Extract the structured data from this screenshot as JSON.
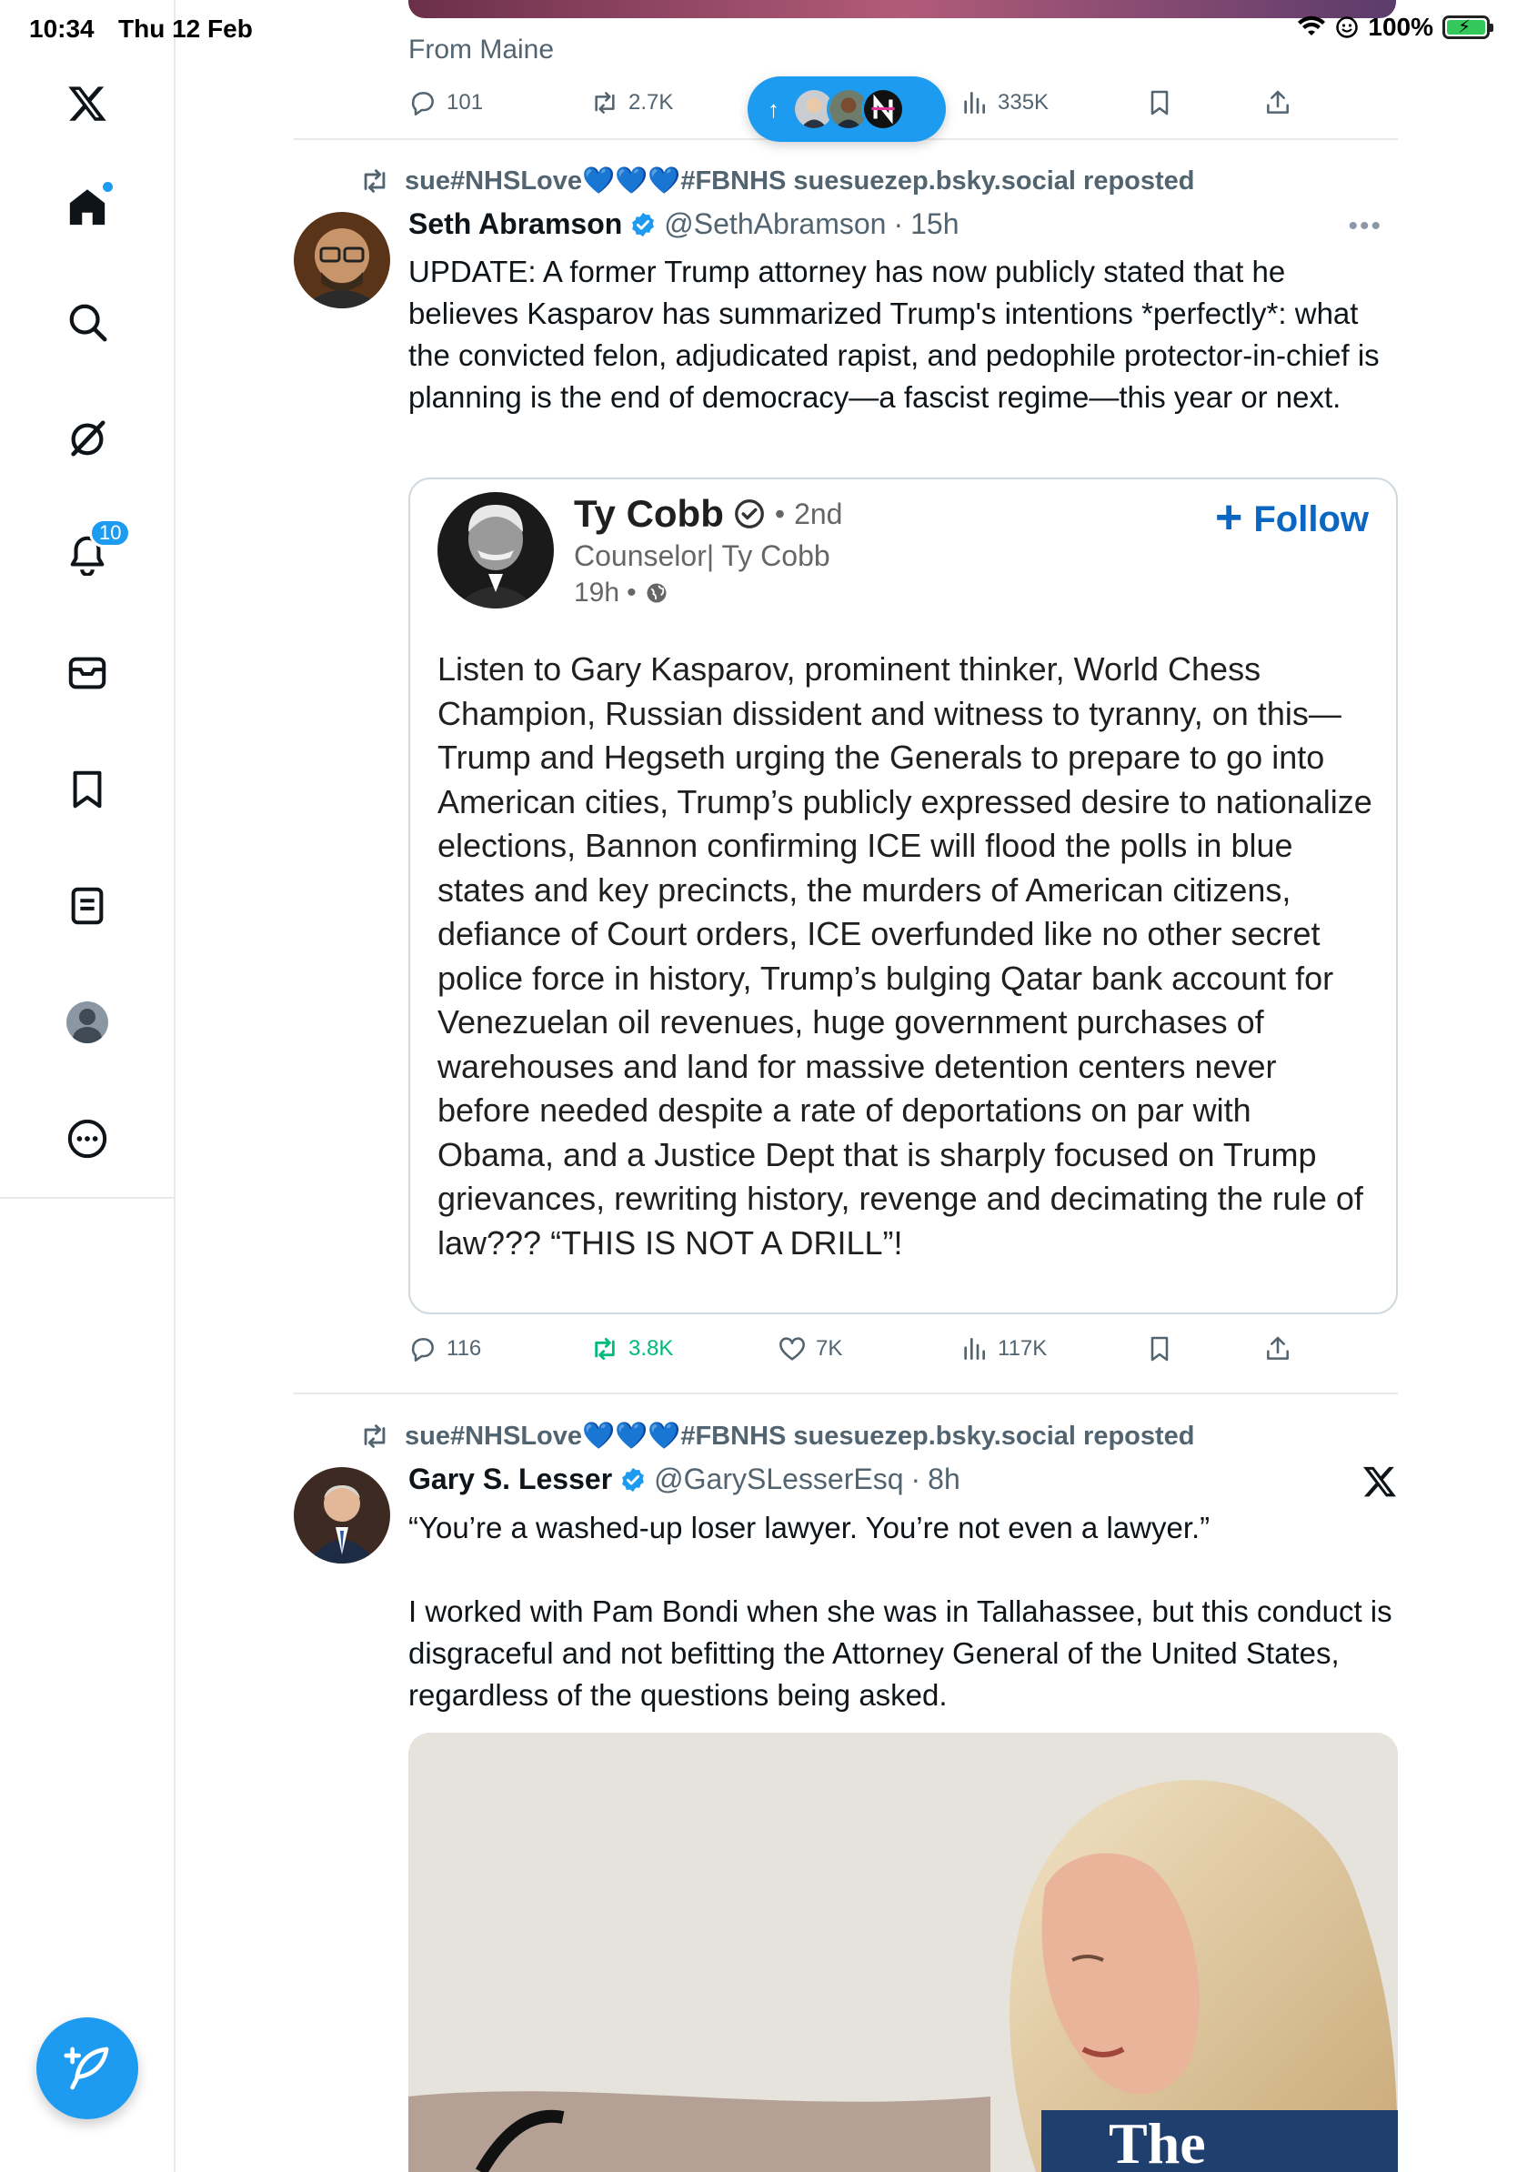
{
  "status_bar": {
    "time": "10:34",
    "date": "Thu 12 Feb",
    "battery": "100%"
  },
  "sidebar": {
    "notification_count": "10",
    "items": [
      "x-logo",
      "home",
      "search",
      "grok",
      "notifications",
      "messages",
      "bookmarks",
      "lists",
      "profile",
      "more"
    ]
  },
  "previous_post": {
    "from_text": "From Maine",
    "replies": "101",
    "reposts": "2.7K",
    "views": "335K"
  },
  "new_posts_pill": {
    "arrow": "↑"
  },
  "post1": {
    "repost_by": "sue#NHSLove💙💙💙#FBNHS suesuezep.bsky.social reposted",
    "name": "Seth Abramson",
    "handle": "@SethAbramson",
    "time": "15h",
    "text": "UPDATE: A former Trump attorney has now publicly stated that he believes Kasparov has summarized Trump's intentions *perfectly*: what the convicted felon, adjudicated rapist, and pedophile protector-in-chief is planning is the end of democracy—a fascist regime—this year or next.",
    "quote": {
      "name": "Ty Cobb",
      "degree": "2nd",
      "headline": "Counselor| Ty Cobb",
      "time": "19h",
      "follow_label": "Follow",
      "body": "Listen to Gary Kasparov, prominent thinker, World Chess Champion, Russian dissident and witness to tyranny, on this—Trump and Hegseth urging the Generals to prepare to go into American cities, Trump’s publicly expressed desire to nationalize elections, Bannon confirming ICE will flood the polls in blue states and key precincts, the murders of American citizens, defiance of Court orders, ICE overfunded like no other secret police force in history, Trump’s bulging Qatar bank account for Venezuelan oil revenues, huge government purchases of warehouses and land for massive detention centers never before needed despite a rate of deportations on par with Obama, and a Justice Dept that is sharply focused on Trump grievances, rewriting history, revenge and decimating the rule of law??? “THIS IS NOT A DRILL”!"
    },
    "replies": "116",
    "reposts": "3.8K",
    "likes": "7K",
    "views": "117K"
  },
  "post2": {
    "repost_by": "sue#NHSLove💙💙💙#FBNHS suesuezep.bsky.social reposted",
    "name": "Gary S. Lesser",
    "handle": "@GarySLesserEsq",
    "time": "8h",
    "text_line1": "“You’re a washed-up loser lawyer. You’re not even a lawyer.”",
    "text_line2": "I worked with Pam Bondi when she was in Tallahassee, but this conduct is disgraceful and not befitting the Attorney General of the United States, regardless of the questions being asked.",
    "media_caption_fragment": "The"
  },
  "colors": {
    "accent": "#1d9bf0",
    "repost_green": "#00ba7c",
    "secondary_text": "#536471",
    "follow_blue": "#0a66c2"
  }
}
